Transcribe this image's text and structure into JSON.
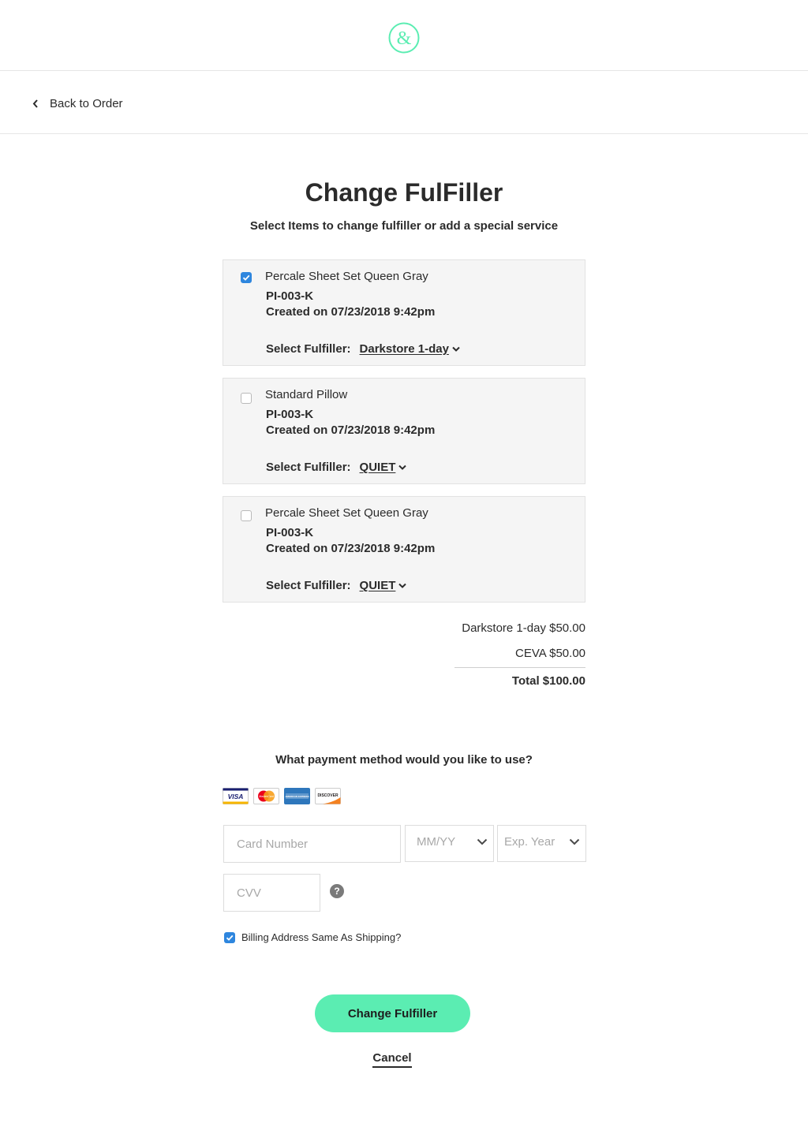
{
  "header": {
    "logo_icon": "ampersand-logo-icon",
    "brand_color": "#5bedb2"
  },
  "nav": {
    "back_label": "Back to Order"
  },
  "page": {
    "title": "Change FulFiller",
    "subtitle": "Select Items to change fulfiller or add a special service"
  },
  "items": [
    {
      "checked": true,
      "name": "Percale Sheet Set Queen Gray",
      "sku": "PI-003-K",
      "created": "Created on 07/23/2018 9:42pm",
      "fulfiller_label": "Select Fulfiller:",
      "fulfiller": "Darkstore 1-day"
    },
    {
      "checked": false,
      "name": "Standard Pillow",
      "sku": "PI-003-K",
      "created": "Created on 07/23/2018 9:42pm",
      "fulfiller_label": "Select Fulfiller:",
      "fulfiller": "QUIET"
    },
    {
      "checked": false,
      "name": "Percale Sheet Set Queen Gray",
      "sku": "PI-003-K",
      "created": "Created on 07/23/2018 9:42pm",
      "fulfiller_label": "Select Fulfiller:",
      "fulfiller": "QUIET"
    }
  ],
  "costs": {
    "lines": [
      "Darkstore 1-day $50.00",
      "CEVA $50.00"
    ],
    "total": "Total $100.00"
  },
  "payment": {
    "question": "What payment method would you like to use?",
    "card_brands": [
      "VISA",
      "MasterCard",
      "AMERICAN EXPRESS",
      "DISCOVER"
    ],
    "card_number_placeholder": "Card Number",
    "exp_month_placeholder": "MM/YY",
    "exp_year_placeholder": "Exp. Year",
    "cvv_placeholder": "CVV",
    "help_glyph": "?",
    "billing_same_label": "Billing Address Same As Shipping?",
    "billing_same_checked": true
  },
  "actions": {
    "submit_label": "Change Fulfiller",
    "cancel_label": "Cancel"
  }
}
